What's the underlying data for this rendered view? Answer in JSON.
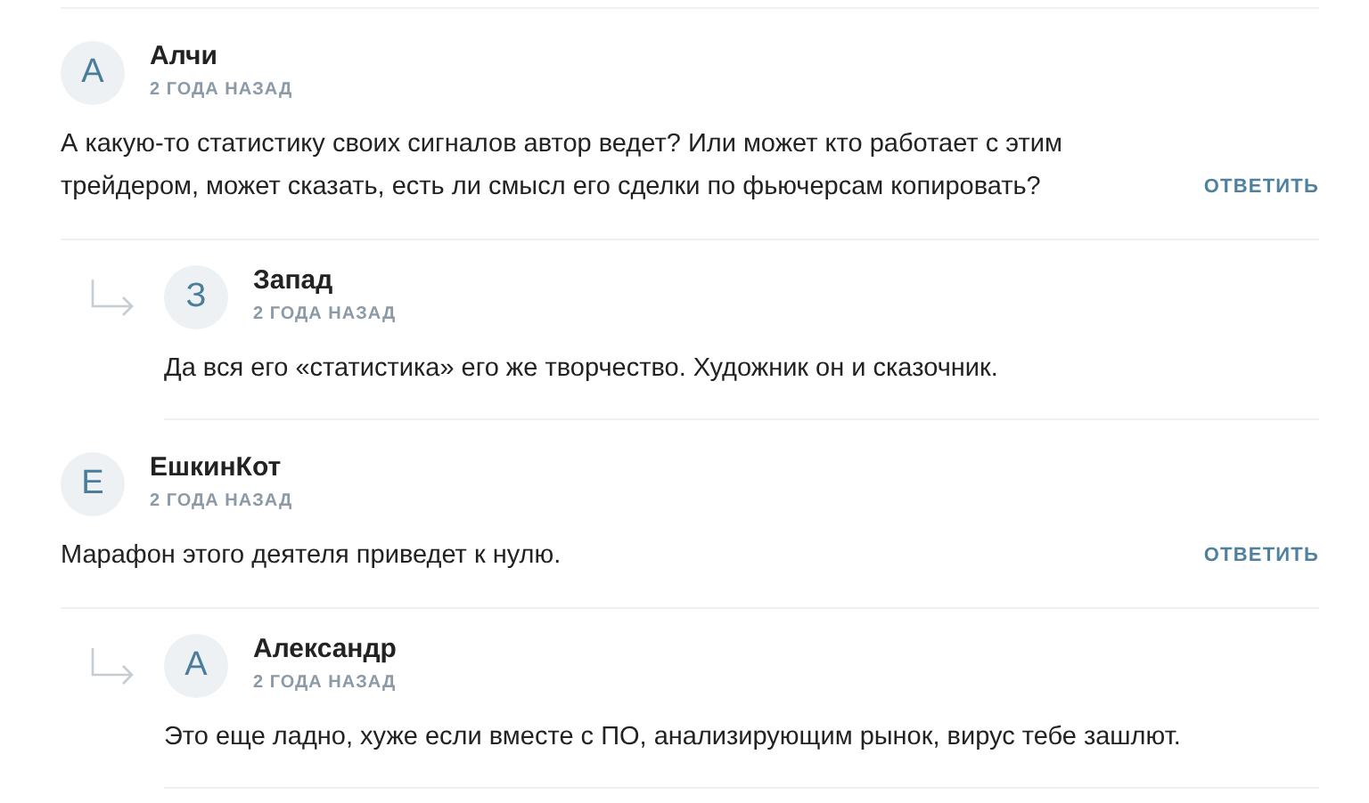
{
  "comments": [
    {
      "avatar": "А",
      "author": "Алчи",
      "time": "2 ГОДА НАЗАД",
      "text": "А какую-то статистику своих сигналов автор ведет? Или может кто работает с этим трейдером, может сказать, есть ли смысл его сделки по фьючерсам копировать?",
      "reply_label": "ОТВЕТИТЬ",
      "children": [
        {
          "avatar": "З",
          "author": "Запад",
          "time": "2 ГОДА НАЗАД",
          "text": "Да вся его «статистика» его же творчество. Художник он и сказочник."
        }
      ]
    },
    {
      "avatar": "Е",
      "author": "ЕшкинКот",
      "time": "2 ГОДА НАЗАД",
      "text": "Марафон этого деятеля приведет к нулю.",
      "reply_label": "ОТВЕТИТЬ",
      "children": [
        {
          "avatar": "А",
          "author": "Александр",
          "time": "2 ГОДА НАЗАД",
          "text": "Это еще ладно, хуже если вместе с ПО, анализирующим рынок, вирус тебе зашлют."
        }
      ]
    }
  ]
}
